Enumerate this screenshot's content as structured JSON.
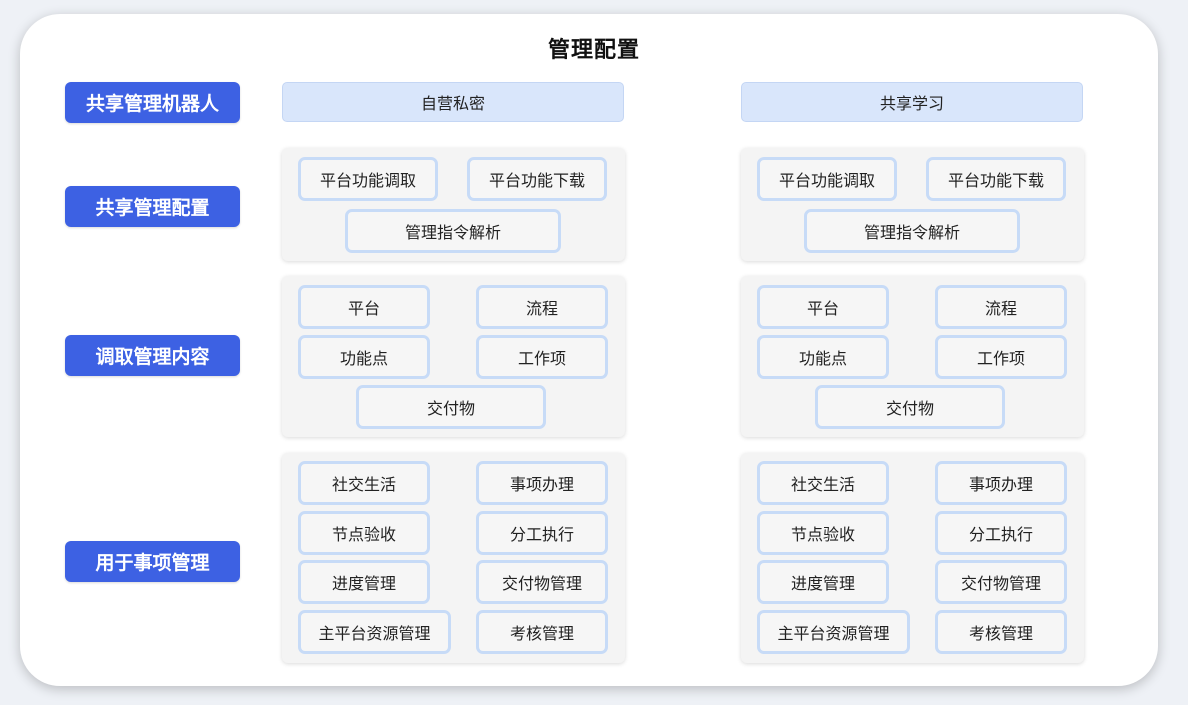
{
  "title": "管理配置",
  "row_labels": [
    "共享管理机器人",
    "共享管理配置",
    "调取管理内容",
    "用于事项管理"
  ],
  "columns": [
    {
      "header": "自营私密",
      "config": [
        "平台功能调取",
        "平台功能下载",
        "管理指令解析"
      ],
      "content": [
        "平台",
        "流程",
        "功能点",
        "工作项",
        "交付物"
      ],
      "usage": [
        "社交生活",
        "事项办理",
        "节点验收",
        "分工执行",
        "进度管理",
        "交付物管理",
        "主平台资源管理",
        "考核管理"
      ]
    },
    {
      "header": "共享学习",
      "config": [
        "平台功能调取",
        "平台功能下载",
        "管理指令解析"
      ],
      "content": [
        "平台",
        "流程",
        "功能点",
        "工作项",
        "交付物"
      ],
      "usage": [
        "社交生活",
        "事项办理",
        "节点验收",
        "分工执行",
        "进度管理",
        "交付物管理",
        "主平台资源管理",
        "考核管理"
      ]
    }
  ],
  "colors": {
    "row_label_bg": "#3d61e3",
    "header_bg": "#d9e6fb",
    "item_border": "#c7dbf7",
    "panel_bg": "#f4f4f4"
  }
}
